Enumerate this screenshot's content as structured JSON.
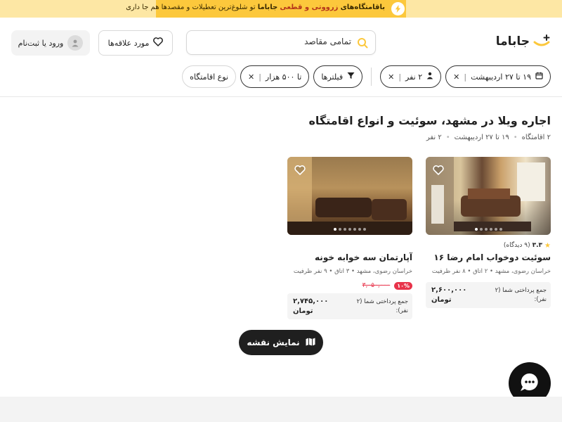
{
  "banner": {
    "highlight": "باقامتگاه‌های",
    "highlight_color": "زرووتی و قطعی",
    "brand": "جاباما",
    "rest": "تو شلوغ‌ترین تعطیلات و مقصدها هم جا داری"
  },
  "header": {
    "logo_text": "جاباما",
    "search_placeholder": "تمامی مقاصد",
    "favorites_label": "مورد علاقه‌ها",
    "login_label": "ورود یا ثبت‌نام"
  },
  "filters": {
    "dates": "۱۹ تا ۲۷ اردیبهشت",
    "guests": "۲ نفر",
    "filters_label": "فیلترها",
    "price": "تا ۵۰۰ هزار",
    "type": "نوع اقامتگاه"
  },
  "main": {
    "title": "اجاره ویلا در مشهد، سوئیت و انواع اقامتگاه",
    "subtitle": {
      "count": "۲ اقامتگاه",
      "dates": "۱۹ تا ۲۷ اردیبهشت",
      "guests": "۲ نفر"
    }
  },
  "listings": [
    {
      "rating": "۳.۳",
      "reviews": "(۹ دیدگاه)",
      "title": "سوئیت دوخواب امام رضا ۱۶",
      "meta": "خراسان رضوی، مشهد • ۲ اتاق • ۸ نفر ظرفیت",
      "discount": "",
      "old_price": "",
      "price_label": "جمع پرداختی شما (۲ نفر):",
      "price": "۲,۶۰۰,۰۰۰",
      "currency": "تومان"
    },
    {
      "rating": "",
      "reviews": "",
      "title": "آپارتمان سه خوابه خونه",
      "meta": "خراسان رضوی، مشهد • ۳ اتاق • ۹ نفر ظرفیت",
      "discount": "۱۰%",
      "old_price": "۳,۰۵۰,۰۰۰",
      "price_label": "جمع پرداختی شما (۲ نفر):",
      "price": "۲,۷۴۵,۰۰۰",
      "currency": "تومان"
    }
  ],
  "map_button": "نمایش نقشه",
  "colors": {
    "accent": "#fcc83c",
    "banner_bg": "#fde7a4",
    "discount": "#e8334a",
    "dark": "#1f1f1f"
  }
}
